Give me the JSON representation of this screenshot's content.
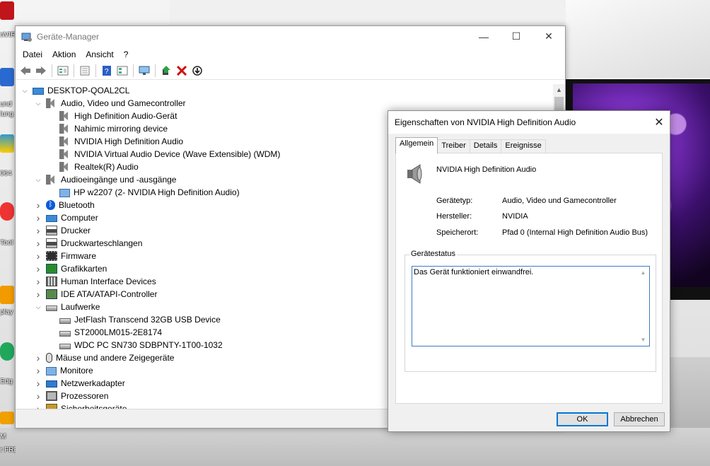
{
  "desktop": {
    "icon_labels": [
      "nVIR",
      "und",
      "lung",
      "064",
      "Tool",
      "play",
      "Edg",
      "M",
      "r FREE"
    ]
  },
  "device_manager": {
    "title": "Geräte-Manager",
    "menu": [
      "Datei",
      "Aktion",
      "Ansicht",
      "?"
    ],
    "window_controls": {
      "minimize": "—",
      "maximize": "☐",
      "close": "✕"
    },
    "toolbar_icons": [
      "back-arrow-icon",
      "forward-arrow-icon",
      "properties-grid-icon",
      "document-icon",
      "help-icon",
      "view-icon",
      "monitor-scan-icon",
      "update-driver-icon",
      "uninstall-icon",
      "disable-icon"
    ],
    "tree": [
      {
        "label": "DESKTOP-QOAL2CL",
        "level": 0,
        "expander": "expanded",
        "icon": "computer-icon"
      },
      {
        "label": "Audio, Video und Gamecontroller",
        "level": 1,
        "expander": "expanded",
        "icon": "speaker-icon"
      },
      {
        "label": "High Definition Audio-Gerät",
        "level": 2,
        "expander": "none",
        "icon": "speaker-icon"
      },
      {
        "label": "Nahimic mirroring device",
        "level": 2,
        "expander": "none",
        "icon": "speaker-icon"
      },
      {
        "label": "NVIDIA High Definition Audio",
        "level": 2,
        "expander": "none",
        "icon": "speaker-icon"
      },
      {
        "label": "NVIDIA Virtual Audio Device (Wave Extensible) (WDM)",
        "level": 2,
        "expander": "none",
        "icon": "speaker-icon"
      },
      {
        "label": "Realtek(R) Audio",
        "level": 2,
        "expander": "none",
        "icon": "speaker-icon"
      },
      {
        "label": "Audioeingänge und -ausgänge",
        "level": 1,
        "expander": "expanded",
        "icon": "speaker-icon"
      },
      {
        "label": "HP w2207 (2- NVIDIA High Definition Audio)",
        "level": 2,
        "expander": "none",
        "icon": "monitor-icon"
      },
      {
        "label": "Bluetooth",
        "level": 1,
        "expander": "collapsed",
        "icon": "bluetooth-icon"
      },
      {
        "label": "Computer",
        "level": 1,
        "expander": "collapsed",
        "icon": "computer-icon"
      },
      {
        "label": "Drucker",
        "level": 1,
        "expander": "collapsed",
        "icon": "printer-icon"
      },
      {
        "label": "Druckwarteschlangen",
        "level": 1,
        "expander": "collapsed",
        "icon": "printer-icon"
      },
      {
        "label": "Firmware",
        "level": 1,
        "expander": "collapsed",
        "icon": "chip-icon"
      },
      {
        "label": "Grafikkarten",
        "level": 1,
        "expander": "collapsed",
        "icon": "graphics-card-icon"
      },
      {
        "label": "Human Interface Devices",
        "level": 1,
        "expander": "collapsed",
        "icon": "keyboard-icon"
      },
      {
        "label": "IDE ATA/ATAPI-Controller",
        "level": 1,
        "expander": "collapsed",
        "icon": "controller-icon"
      },
      {
        "label": "Laufwerke",
        "level": 1,
        "expander": "expanded",
        "icon": "drive-icon"
      },
      {
        "label": "JetFlash Transcend 32GB USB Device",
        "level": 2,
        "expander": "none",
        "icon": "drive-icon"
      },
      {
        "label": "ST2000LM015-2E8174",
        "level": 2,
        "expander": "none",
        "icon": "drive-icon"
      },
      {
        "label": "WDC PC SN730 SDBPNTY-1T00-1032",
        "level": 2,
        "expander": "none",
        "icon": "drive-icon"
      },
      {
        "label": "Mäuse und andere Zeigegeräte",
        "level": 1,
        "expander": "collapsed",
        "icon": "mouse-icon"
      },
      {
        "label": "Monitore",
        "level": 1,
        "expander": "collapsed",
        "icon": "monitor-icon"
      },
      {
        "label": "Netzwerkadapter",
        "level": 1,
        "expander": "collapsed",
        "icon": "network-icon"
      },
      {
        "label": "Prozessoren",
        "level": 1,
        "expander": "collapsed",
        "icon": "processor-icon"
      },
      {
        "label": "Sicherheitsgeräte",
        "level": 1,
        "expander": "collapsed",
        "icon": "security-icon"
      }
    ]
  },
  "properties_dialog": {
    "title": "Eigenschaften von NVIDIA High Definition Audio",
    "close": "✕",
    "tabs": [
      "Allgemein",
      "Treiber",
      "Details",
      "Ereignisse"
    ],
    "active_tab": "Allgemein",
    "device_name": "NVIDIA High Definition Audio",
    "properties": [
      {
        "label": "Gerätetyp:",
        "value": "Audio, Video und Gamecontroller"
      },
      {
        "label": "Hersteller:",
        "value": "NVIDIA"
      },
      {
        "label": "Speicherort:",
        "value": "Pfad 0 (Internal High Definition Audio Bus)"
      }
    ],
    "status_group_label": "Gerätestatus",
    "status_text": "Das Gerät funktioniert einwandfrei.",
    "ok_label": "OK",
    "cancel_label": "Abbrechen",
    "colors": {
      "accent": "#0078d7"
    }
  }
}
